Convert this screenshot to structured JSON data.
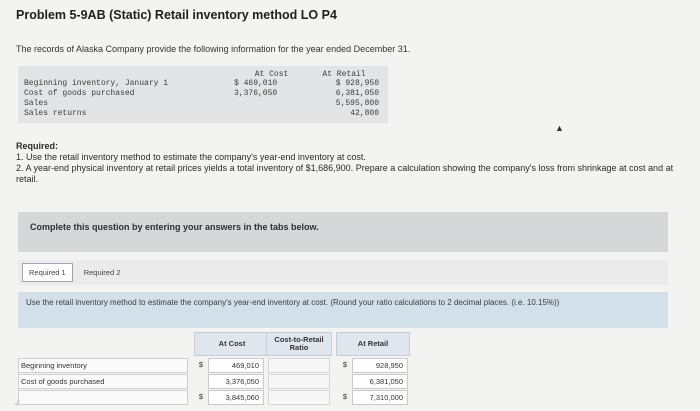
{
  "header": {
    "title": "Problem 5-9AB (Static) Retail inventory method LO P4",
    "intro": "The records of Alaska Company provide the following information for the year ended December 31."
  },
  "info_table": {
    "col_cost": "At Cost",
    "col_retail": "At Retail",
    "rows": [
      {
        "label": "Beginning inventory, January 1",
        "cost": "$ 469,010",
        "retail": "$ 928,950"
      },
      {
        "label": "Cost of goods purchased",
        "cost": "3,376,050",
        "retail": "6,381,050"
      },
      {
        "label": "Sales",
        "cost": "",
        "retail": "5,595,800"
      },
      {
        "label": "Sales returns",
        "cost": "",
        "retail": "42,800"
      }
    ]
  },
  "required": {
    "heading": "Required:",
    "item1": "1. Use the retail inventory method to estimate the company's year-end inventory at cost.",
    "item2": "2. A year-end physical inventory at retail prices yields a total inventory of $1,686,900. Prepare a calculation showing the company's loss from shrinkage at cost and at retail."
  },
  "complete_prompt": "Complete this question by entering your answers in the tabs below.",
  "tabs": [
    {
      "label": "Required 1"
    },
    {
      "label": "Required 2"
    }
  ],
  "instruction": "Use the retail inventory method to estimate the company's year-end inventory at cost. (Round your ratio calculations to 2 decimal places. (i.e. 10.15%))",
  "calc": {
    "col_cost": "At Cost",
    "col_ratio": "Cost-to-Retail Ratio",
    "col_retail": "At Retail",
    "rows": [
      {
        "label": "Beginning inventory",
        "cost_sign": "$",
        "cost": "469,010",
        "retail_sign": "$",
        "retail": "928,950"
      },
      {
        "label": "Cost of goods purchased",
        "cost_sign": "",
        "cost": "3,376,050",
        "retail_sign": "",
        "retail": "6,381,050"
      },
      {
        "label": "",
        "cost_sign": "$",
        "cost": "3,845,060",
        "retail_sign": "$",
        "retail": "7,310,000"
      }
    ]
  }
}
